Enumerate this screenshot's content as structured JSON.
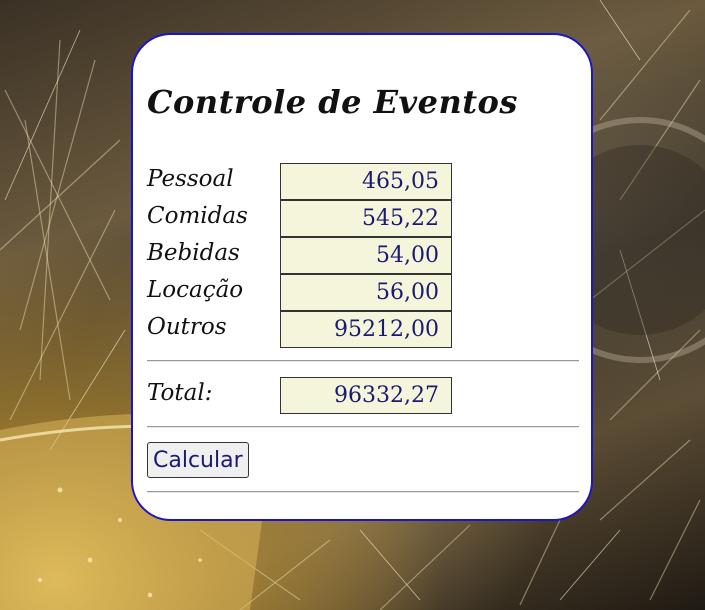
{
  "form": {
    "title": "Controle de Eventos",
    "fields": [
      {
        "label": "Pessoal",
        "value": "465,05"
      },
      {
        "label": "Comidas",
        "value": "545,22"
      },
      {
        "label": "Bebidas",
        "value": "54,00"
      },
      {
        "label": "Locação",
        "value": "56,00"
      },
      {
        "label": "Outros",
        "value": "95212,00"
      }
    ],
    "total": {
      "label": "Total:",
      "value": "96332,27"
    },
    "calculate_button": "Calcular"
  },
  "colors": {
    "card_border": "#1a15c8",
    "input_background": "#f5f5dc",
    "input_text": "#1a1a70"
  }
}
